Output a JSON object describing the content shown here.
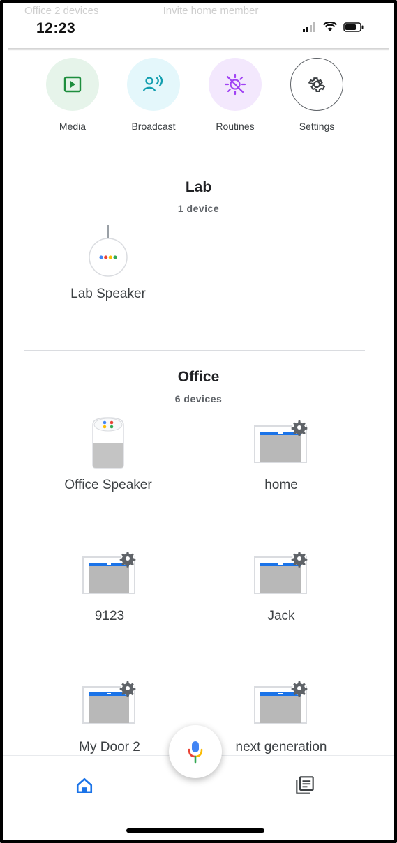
{
  "status_bar": {
    "time": "12:23"
  },
  "ghost_header": {
    "left": "Office 2 devices",
    "right": "Invite home member"
  },
  "quick_actions": [
    {
      "label": "Media",
      "icon": "media-play-icon",
      "bg": "#e6f4ea",
      "fg": "#1e8e3e"
    },
    {
      "label": "Broadcast",
      "icon": "broadcast-icon",
      "bg": "#e4f7fb",
      "fg": "#129eaf"
    },
    {
      "label": "Routines",
      "icon": "routines-sun-icon",
      "bg": "#f3e8fd",
      "fg": "#a142f4"
    },
    {
      "label": "Settings",
      "icon": "gear-icon",
      "bg": "#ffffff",
      "fg": "#5f6368"
    }
  ],
  "rooms": [
    {
      "name": "Lab",
      "count": "1 device",
      "devices": [
        {
          "label": "Lab Speaker",
          "icon": "speaker-mini-icon"
        }
      ]
    },
    {
      "name": "Office",
      "count": "6 devices",
      "devices": [
        {
          "label": "Office Speaker",
          "icon": "google-home-speaker-icon"
        },
        {
          "label": "home",
          "icon": "garage-door-icon"
        },
        {
          "label": "9123",
          "icon": "garage-door-icon"
        },
        {
          "label": "Jack",
          "icon": "garage-door-icon"
        },
        {
          "label": "My Door 2",
          "icon": "garage-door-icon"
        },
        {
          "label": "next generation",
          "icon": "garage-door-icon"
        }
      ]
    }
  ],
  "colors": {
    "accent": "#1a73e8",
    "text": "#3c4043",
    "divider": "#dadce0"
  }
}
